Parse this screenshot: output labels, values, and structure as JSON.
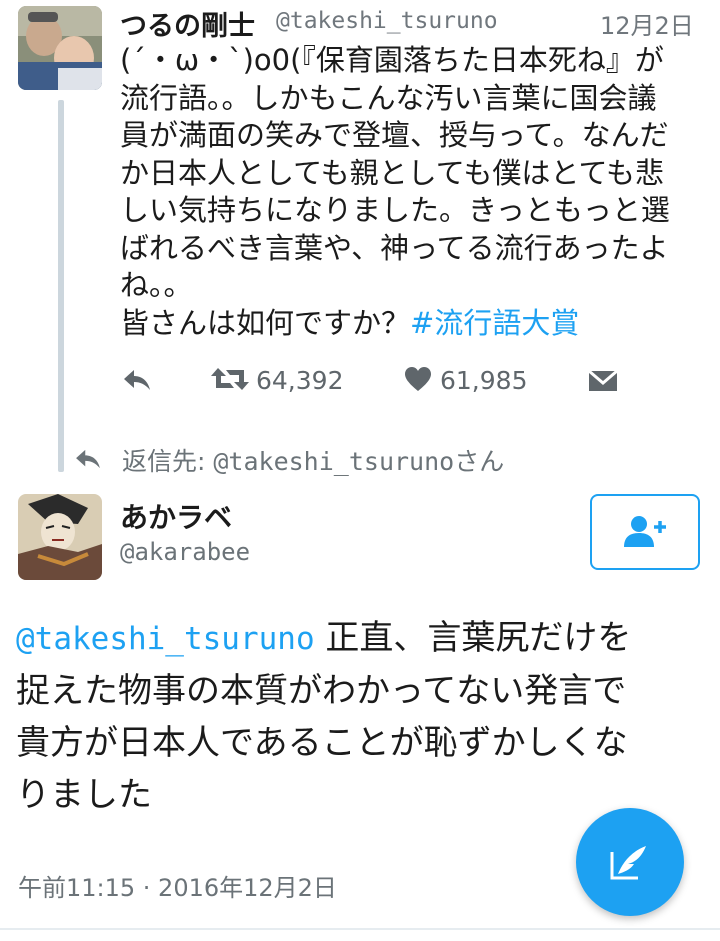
{
  "parent_tweet": {
    "display_name": "つるの剛士",
    "handle": "@takeshi_tsuruno",
    "date": "12月2日",
    "lines": [
      "(´・ω・`)o0(『保育園落ちた日本死ね』が",
      "流行語。。しかもこんな汚い言葉に国会議",
      "員が満面の笑みで登壇、授与って。なんだ",
      "か日本人としても親としても僕はとても悲",
      "しい気持ちになりました。きっともっと選",
      "ばれるべき言葉や、神ってる流行あったよ",
      "ね。。"
    ],
    "last_line_text": "皆さんは如何ですか？",
    "hashtag": "#流行語大賞",
    "retweet_count": "64,392",
    "like_count": "61,985",
    "reply_to_prefix": "返信先: ",
    "reply_to_handle": "@takeshi_tsuruno",
    "reply_to_suffix": "さん"
  },
  "main_tweet": {
    "display_name": "あかラベ",
    "handle": "@akarabee",
    "mention": "@takeshi_tsuruno",
    "line1_text": " 正直、言葉尻だけを",
    "lines": [
      "捉えた物事の本質がわかってない発言で",
      "貴方が日本人であることが恥ずかしくな",
      "りました"
    ],
    "timestamp": "午前11:15 · 2016年12月2日"
  },
  "colors": {
    "accent": "#1da1f2",
    "text": "#1b1b1b",
    "secondary": "#6b7378",
    "thread_line": "#ccd6dd"
  },
  "icons": {
    "reply": "reply-arrow-icon",
    "retweet": "retweet-icon",
    "like": "heart-icon",
    "dm": "envelope-icon",
    "follow": "add-user-icon",
    "compose": "compose-feather-icon"
  }
}
